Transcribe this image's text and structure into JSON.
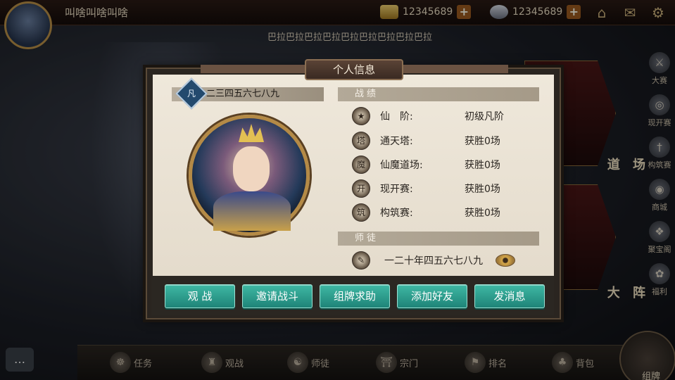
{
  "top_bar": {
    "player_name": "叫啥叫啥叫啥",
    "gold_amount": "12345689",
    "silver_amount": "12345689",
    "plus": "+"
  },
  "marquee": "巴拉巴拉巴拉巴拉巴拉巴拉巴拉巴拉巴拉",
  "side_menu": [
    "大赛",
    "现开赛",
    "构筑赛",
    "商城",
    "聚宝阁",
    "福利"
  ],
  "hex_cards": [
    "道 场",
    "大 阵"
  ],
  "bottom_nav": [
    "任务",
    "观战",
    "师徒",
    "宗门",
    "排名",
    "背包"
  ],
  "deck_label": "组牌",
  "dialog": {
    "title": "个人信息",
    "player_name": "一二三四五六七八九",
    "rank_glyph": "凡",
    "record_header": "战绩",
    "stats": [
      {
        "icon": "★",
        "label": "仙　阶:",
        "value": "初级凡阶"
      },
      {
        "icon": "塔",
        "label": "通天塔:",
        "value": "获胜0场"
      },
      {
        "icon": "魔",
        "label": "仙魔道场:",
        "value": "获胜0场"
      },
      {
        "icon": "开",
        "label": "现开赛:",
        "value": "获胜0场"
      },
      {
        "icon": "筑",
        "label": "构筑赛:",
        "value": "获胜0场"
      }
    ],
    "master_header": "师徒",
    "master_name": "一二十年四五六七八九",
    "buttons": [
      "观 战",
      "邀请战斗",
      "组牌求助",
      "添加好友",
      "发消息"
    ]
  },
  "colors": {
    "button_teal": "#2a9e8e",
    "parchment": "#e9e1d2",
    "frame": "#2a2520",
    "gold": "#b48a46"
  }
}
